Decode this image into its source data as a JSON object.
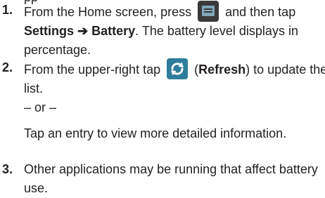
{
  "steps": [
    {
      "number": "1.",
      "text_before_icon": "From the Home screen, press",
      "icon": "menu-icon",
      "text_after_icon": "and then tap",
      "settings_label": "Settings",
      "arrow": "➔",
      "battery_label": "Battery",
      "text_tail_1": ". The battery level displays in",
      "text_tail_2": "percentage."
    },
    {
      "number": "2.",
      "text_before_icon": "From the upper-right tap",
      "icon": "refresh-icon",
      "refresh_label": "Refresh",
      "text_after_icon": "to update the",
      "text_tail": "list.",
      "or_separator": "– or –",
      "alternate_text": "Tap an entry to view more detailed information."
    },
    {
      "number": "3.",
      "line_1": "Other applications may be running that affect battery",
      "line_2": "use."
    }
  ]
}
